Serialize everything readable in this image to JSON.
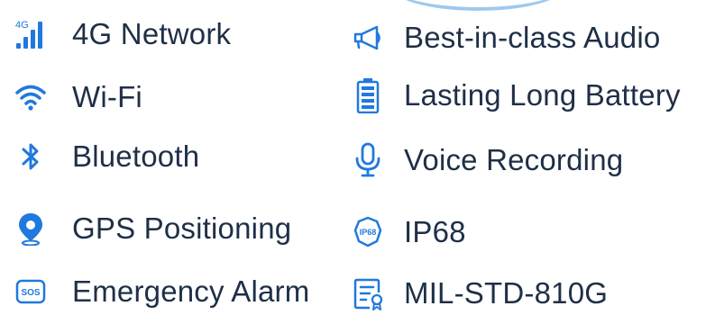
{
  "colors": {
    "icon_blue": "#2079dd",
    "text": "#1f2f47",
    "arc": "#9ec9ee"
  },
  "features_left": [
    {
      "icon": "4g-signal-icon",
      "icon_text": "4G",
      "label": "4G Network"
    },
    {
      "icon": "wifi-icon",
      "label": "Wi-Fi"
    },
    {
      "icon": "bluetooth-icon",
      "label": "Bluetooth"
    },
    {
      "icon": "location-pin-icon",
      "label": "GPS Positioning"
    },
    {
      "icon": "sos-icon",
      "icon_text": "SOS",
      "label": "Emergency Alarm"
    }
  ],
  "features_right": [
    {
      "icon": "megaphone-icon",
      "label": "Best-in-class Audio"
    },
    {
      "icon": "battery-icon",
      "label": "Lasting Long Battery"
    },
    {
      "icon": "microphone-icon",
      "label": "Voice Recording"
    },
    {
      "icon": "ip68-badge-icon",
      "icon_text": "IP68",
      "label": "IP68"
    },
    {
      "icon": "certificate-icon",
      "label": "MIL-STD-810G"
    }
  ]
}
